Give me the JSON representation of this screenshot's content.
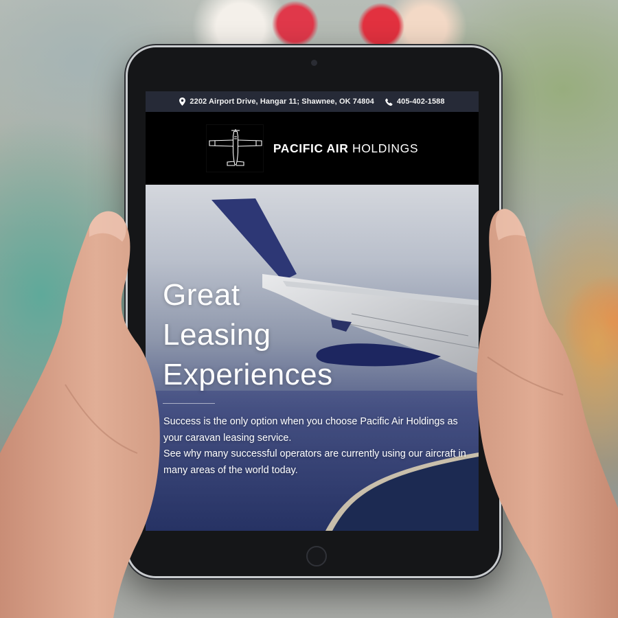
{
  "topbar": {
    "address": "2202 Airport Drive, Hangar 11;  Shawnee, OK 74804",
    "phone": "405-402-1588",
    "icons": [
      "location-pin-icon",
      "phone-icon"
    ]
  },
  "header": {
    "brand_bold": "PACIFIC AIR",
    "brand_light": "HOLDINGS",
    "logo_icon": "airplane-icon"
  },
  "hero": {
    "title_lines": [
      "Great",
      "Leasing",
      "Experiences"
    ],
    "paragraph_1": "Success is the only option when you choose Pacific Air Holdings as your caravan leasing service.",
    "paragraph_2": "See why many successful operators are currently using our aircraft in many areas of the world today."
  },
  "colors": {
    "topbar_bg": "#262a37",
    "header_bg": "#000000",
    "hero_text": "#ffffff"
  }
}
